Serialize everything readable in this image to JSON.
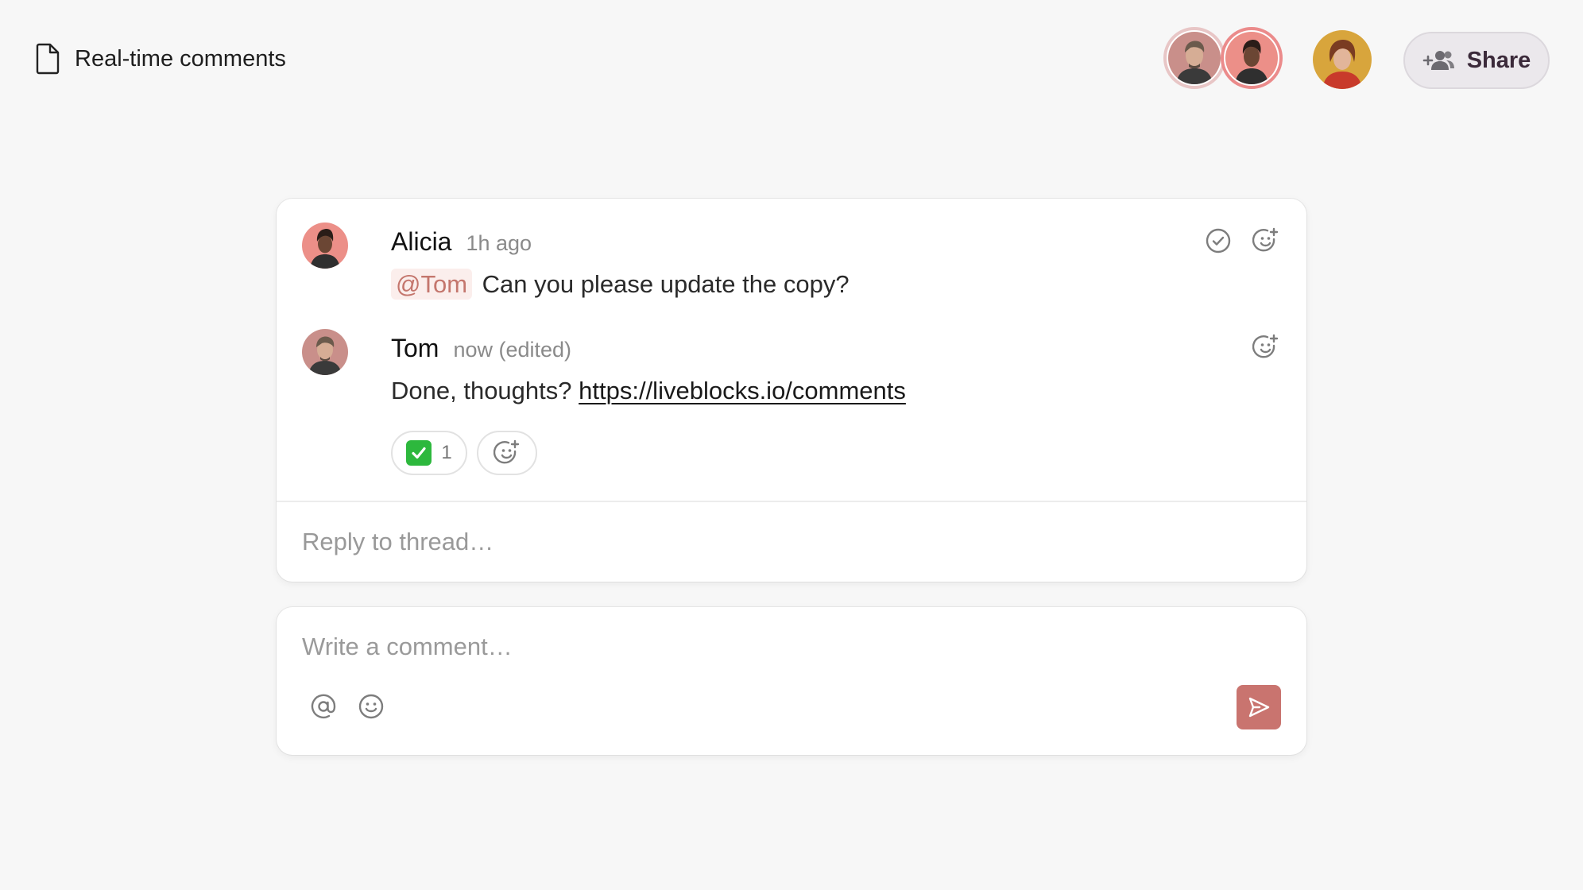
{
  "header": {
    "doc_icon": "document-icon",
    "doc_title": "Real-time comments",
    "presence": [
      {
        "user": "Tom",
        "icon": "avatar-tom"
      },
      {
        "user": "Alicia",
        "icon": "avatar-alicia"
      },
      {
        "user": "guest",
        "icon": "avatar-guest"
      }
    ],
    "share_icon": "users-plus-icon",
    "share_label": "Share"
  },
  "thread": {
    "comments": [
      {
        "author": "Alicia",
        "time": "1h ago",
        "mention": "@Tom",
        "body": "Can you please update the copy?",
        "actions": [
          "resolve-icon",
          "add-reaction-icon"
        ]
      },
      {
        "author": "Tom",
        "time": "now (edited)",
        "body": "Done, thoughts?",
        "link": "https://liveblocks.io/comments",
        "actions": [
          "add-reaction-icon"
        ],
        "reactions": [
          {
            "emoji": "✅",
            "count": "1"
          }
        ]
      }
    ],
    "reply_placeholder": "Reply to thread…"
  },
  "composer": {
    "placeholder": "Write a comment…",
    "tools": [
      "mention-icon",
      "emoji-icon"
    ],
    "send_icon": "send-icon"
  },
  "colors": {
    "background": "#f7f7f7",
    "accent": "#c9746f",
    "mention_text": "#c4766d",
    "mention_bg": "#fbeeec",
    "ring": "#eb8b8b",
    "reaction_check": "#2db83d"
  }
}
